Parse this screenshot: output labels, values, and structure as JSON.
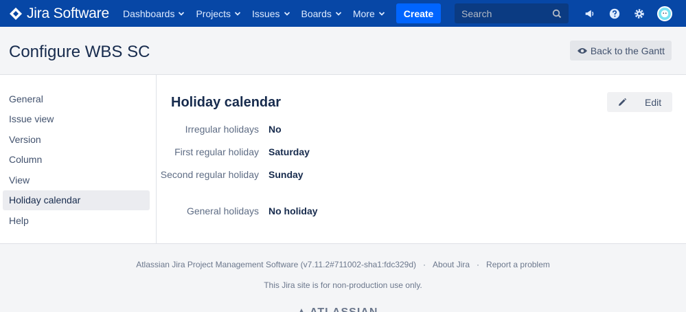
{
  "nav": {
    "logo_text": "Jira Software",
    "items": [
      {
        "label": "Dashboards"
      },
      {
        "label": "Projects"
      },
      {
        "label": "Issues"
      },
      {
        "label": "Boards"
      },
      {
        "label": "More"
      }
    ],
    "create_label": "Create",
    "search_placeholder": "Search",
    "icons": [
      "megaphone-icon",
      "help-icon",
      "settings-icon",
      "avatar"
    ]
  },
  "header": {
    "title": "Configure WBS SC",
    "back_label": "Back to the Gantt"
  },
  "sidebar": {
    "items": [
      {
        "label": "General"
      },
      {
        "label": "Issue view"
      },
      {
        "label": "Version"
      },
      {
        "label": "Column"
      },
      {
        "label": "View"
      },
      {
        "label": "Holiday calendar",
        "active": true
      },
      {
        "label": "Help"
      }
    ]
  },
  "main": {
    "title": "Holiday calendar",
    "edit_label": "Edit",
    "fields": [
      {
        "label": "Irregular holidays",
        "value": "No"
      },
      {
        "label": "First regular holiday",
        "value": "Saturday"
      },
      {
        "label": "Second regular holiday",
        "value": "Sunday"
      },
      {
        "label": "General holidays",
        "value": "No holiday"
      }
    ]
  },
  "footer": {
    "software": "Atlassian Jira Project Management Software (v7.11.2#711002-sha1:fdc329d)",
    "about": "About Jira",
    "report": "Report a problem",
    "notice": "This Jira site is for non-production use only.",
    "brand": "ATLASSIAN"
  },
  "colors": {
    "nav_bg": "#0747a6",
    "create_bg": "#0065ff",
    "text": "#172b4d"
  }
}
